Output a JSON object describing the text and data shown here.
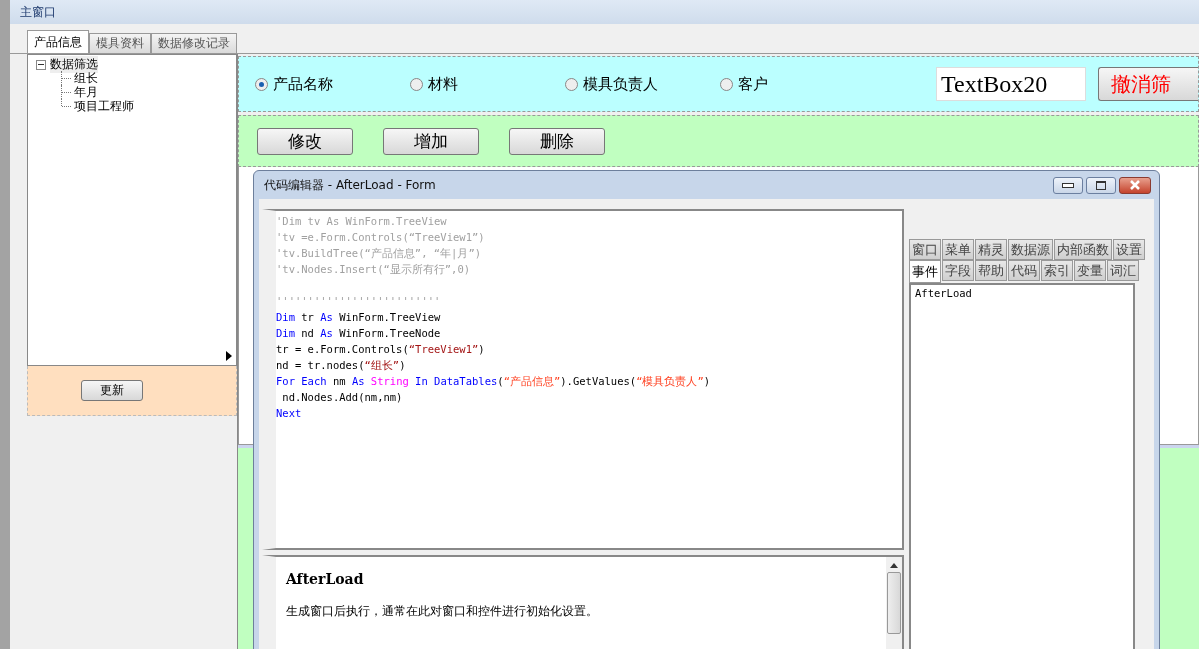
{
  "window": {
    "title": "主窗口"
  },
  "tabs": [
    {
      "label": "产品信息",
      "selected": true
    },
    {
      "label": "模具资料",
      "selected": false
    },
    {
      "label": "数据修改记录",
      "selected": false
    }
  ],
  "tree": {
    "label": "数据筛选",
    "expanded": true,
    "children": [
      {
        "label": "组长"
      },
      {
        "label": "年月"
      },
      {
        "label": "项目工程师"
      }
    ]
  },
  "refresh_button": "更新",
  "filter": {
    "options": [
      {
        "label": "产品名称",
        "selected": true
      },
      {
        "label": "材料",
        "selected": false
      },
      {
        "label": "模具负责人",
        "selected": false
      },
      {
        "label": "客户",
        "selected": false
      }
    ],
    "textbox": "TextBox20",
    "cancel_button": "撤消筛"
  },
  "actions": [
    "修改",
    "增加",
    "删除"
  ],
  "editor": {
    "title": "代码编辑器 - AfterLoad - Form",
    "code": [
      {
        "kind": "code",
        "tokens": [
          {
            "kind": "comment",
            "text": "'Dim tv As WinForm.TreeView"
          }
        ]
      },
      {
        "kind": "code",
        "tokens": [
          {
            "kind": "comment",
            "text": "'tv =e.Form.Controls(“TreeView1”)"
          }
        ]
      },
      {
        "kind": "code",
        "tokens": [
          {
            "kind": "comment",
            "text": "'tv.BuildTree(“产品信息”, “年|月”)"
          }
        ]
      },
      {
        "kind": "code",
        "tokens": [
          {
            "kind": "comment",
            "text": "'tv.Nodes.Insert(“显示所有行”,0)"
          }
        ]
      },
      {
        "kind": "blank"
      },
      {
        "kind": "code",
        "tokens": [
          {
            "kind": "comment",
            "text": "''''''''''''''''''''''''''"
          }
        ]
      },
      {
        "kind": "code",
        "tokens": [
          {
            "kind": "keyword",
            "text": "Dim"
          },
          {
            "kind": "plain",
            "text": " tr "
          },
          {
            "kind": "keyword",
            "text": "As"
          },
          {
            "kind": "plain",
            "text": " WinForm.TreeView"
          }
        ]
      },
      {
        "kind": "code",
        "tokens": [
          {
            "kind": "keyword",
            "text": "Dim"
          },
          {
            "kind": "plain",
            "text": " nd "
          },
          {
            "kind": "keyword",
            "text": "As"
          },
          {
            "kind": "plain",
            "text": " WinForm.TreeNode"
          }
        ]
      },
      {
        "kind": "code",
        "tokens": [
          {
            "kind": "plain",
            "text": "tr = e.Form.Controls("
          },
          {
            "kind": "string",
            "text": "“TreeView1”"
          },
          {
            "kind": "plain",
            "text": ")"
          }
        ]
      },
      {
        "kind": "code",
        "tokens": [
          {
            "kind": "plain",
            "text": "nd = tr.nodes("
          },
          {
            "kind": "string",
            "text": "“组长”"
          },
          {
            "kind": "plain",
            "text": ")"
          }
        ]
      },
      {
        "kind": "code",
        "tokens": [
          {
            "kind": "keyword",
            "text": "For Each"
          },
          {
            "kind": "plain",
            "text": " nm "
          },
          {
            "kind": "keyword",
            "text": "As"
          },
          {
            "kind": "type",
            "text": " String"
          },
          {
            "kind": "keyword",
            "text": " In DataTables"
          },
          {
            "kind": "plain",
            "text": "("
          },
          {
            "kind": "string2",
            "text": "“产品信息”"
          },
          {
            "kind": "plain",
            "text": ").GetValues("
          },
          {
            "kind": "string2",
            "text": "“模具负责人”"
          },
          {
            "kind": "plain",
            "text": ")"
          }
        ]
      },
      {
        "kind": "code",
        "tokens": [
          {
            "kind": "plain",
            "text": " nd.Nodes.Add(nm,nm)"
          }
        ]
      },
      {
        "kind": "code",
        "tokens": [
          {
            "kind": "keyword",
            "text": "Next"
          }
        ]
      }
    ],
    "side_tabs_top": [
      {
        "label": "窗口",
        "selected": false
      },
      {
        "label": "菜单",
        "selected": false
      },
      {
        "label": "精灵",
        "selected": false
      },
      {
        "label": "数据源",
        "selected": false
      },
      {
        "label": "内部函数",
        "selected": false
      },
      {
        "label": "设置",
        "selected": false
      }
    ],
    "side_tabs_bottom": [
      {
        "label": "事件",
        "selected": true
      },
      {
        "label": "字段",
        "selected": false
      },
      {
        "label": "帮助",
        "selected": false
      },
      {
        "label": "代码",
        "selected": false
      },
      {
        "label": "索引",
        "selected": false
      },
      {
        "label": "变量",
        "selected": false
      },
      {
        "label": "词汇",
        "selected": false
      }
    ],
    "events": [
      "AfterLoad"
    ],
    "help": {
      "title": "AfterLoad",
      "text": "生成窗口后执行，通常在此对窗口和控件进行初始化设置。"
    }
  }
}
